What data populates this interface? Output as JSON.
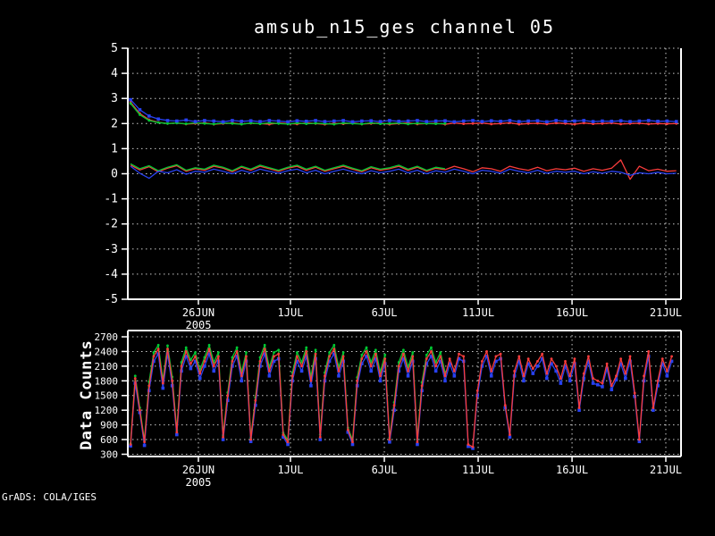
{
  "title": "amsub_n15_ges channel 05",
  "footer": "GrADS: COLA/IGES",
  "colors": {
    "background": "#000000",
    "foreground": "#ffffff",
    "grid": "#c8c8c8",
    "red": "#fa3c3c",
    "green": "#00c832",
    "blue": "#2841f0"
  },
  "chart_data": [
    {
      "type": "line",
      "panel": "top",
      "title": "amsub_n15_ges channel 05",
      "xlabel": "",
      "ylabel": "",
      "ylim": [
        -5,
        5
      ],
      "yticks": [
        5,
        4,
        3,
        2,
        1,
        0,
        -1,
        -2,
        -3,
        -4,
        -5
      ],
      "grid": "dotted",
      "frame_top_solid": false,
      "xticks": {
        "fracs": [
          0.1276,
          0.294,
          0.4637,
          0.6333,
          0.803,
          0.9725
        ],
        "labels": [
          "26JUN",
          "1JUL",
          "6JUL",
          "11JUL",
          "16JUL",
          "21JUL"
        ],
        "sublabel": "2005",
        "sublabel_index": 0
      },
      "series": [
        {
          "name": "red-line-upper",
          "color": "red",
          "marker": "circle",
          "x_start_frac": 0.005,
          "x_step_frac": 0.01672,
          "values": [
            2.85,
            2.4,
            2.15,
            2.05,
            2.0,
            2.02,
            1.98,
            2.0,
            2.03,
            1.97,
            2.0,
            2.02,
            1.98,
            2.01,
            2.0,
            1.97,
            2.02,
            2.0,
            1.98,
            2.03,
            2.0,
            1.97,
            2.01,
            1.99,
            2.02,
            1.98,
            2.0,
            2.02,
            1.97,
            2.0,
            2.03,
            1.98,
            2.0,
            2.01,
            1.97,
            2.02,
            1.99,
            2.0,
            2.02,
            1.98,
            2.0,
            2.03,
            1.97,
            2.0,
            2.01,
            1.98,
            2.02,
            2.0,
            1.97,
            2.02,
            1.99,
            2.0,
            2.02,
            1.98,
            2.0,
            2.01,
            1.98,
            2.0,
            1.99,
            2.0
          ]
        },
        {
          "name": "green-line-upper",
          "color": "green",
          "marker": "circle",
          "x_start_frac": 0.005,
          "x_step_frac": 0.01672,
          "values": [
            2.8,
            2.35,
            2.12,
            2.04,
            2.0,
            2.02,
            1.99,
            2.03,
            2.0,
            1.98,
            2.02,
            2.0,
            1.97,
            2.02,
            1.99,
            2.03,
            2.0,
            1.98,
            2.02,
            1.99,
            2.01,
            2.0,
            1.97,
            2.02,
            2.0,
            1.98,
            2.03,
            1.99,
            2.0,
            2.02,
            1.98,
            2.01,
            2.0,
            1.99,
            2.0
          ]
        },
        {
          "name": "blue-line-upper",
          "color": "blue",
          "marker": "square",
          "x_start_frac": 0.005,
          "x_step_frac": 0.01672,
          "values": [
            2.95,
            2.55,
            2.3,
            2.18,
            2.12,
            2.1,
            2.14,
            2.08,
            2.12,
            2.1,
            2.07,
            2.12,
            2.09,
            2.11,
            2.08,
            2.12,
            2.1,
            2.07,
            2.11,
            2.09,
            2.12,
            2.08,
            2.1,
            2.12,
            2.07,
            2.1,
            2.11,
            2.08,
            2.12,
            2.09,
            2.1,
            2.12,
            2.08,
            2.1,
            2.11,
            2.07,
            2.1,
            2.12,
            2.08,
            2.11,
            2.09,
            2.12,
            2.08,
            2.1,
            2.11,
            2.07,
            2.12,
            2.09,
            2.1,
            2.12,
            2.08,
            2.1,
            2.09,
            2.11,
            2.08,
            2.1,
            2.12,
            2.09,
            2.1,
            2.08
          ]
        },
        {
          "name": "red-line-lower",
          "color": "red",
          "marker": "none",
          "x_start_frac": 0.005,
          "x_step_frac": 0.01672,
          "values": [
            0.35,
            0.15,
            0.28,
            0.08,
            0.22,
            0.32,
            0.1,
            0.2,
            0.14,
            0.3,
            0.22,
            0.08,
            0.26,
            0.14,
            0.3,
            0.2,
            0.1,
            0.22,
            0.3,
            0.14,
            0.26,
            0.1,
            0.2,
            0.3,
            0.18,
            0.08,
            0.24,
            0.14,
            0.2,
            0.3,
            0.14,
            0.26,
            0.1,
            0.22,
            0.16,
            0.3,
            0.2,
            0.08,
            0.24,
            0.2,
            0.1,
            0.3,
            0.2,
            0.14,
            0.26,
            0.12,
            0.2,
            0.16,
            0.22,
            0.1,
            0.2,
            0.14,
            0.22,
            0.55,
            -0.22,
            0.3,
            0.12,
            0.18,
            0.1,
            0.12
          ]
        },
        {
          "name": "green-line-lower",
          "color": "green",
          "marker": "none",
          "x_start_frac": 0.005,
          "x_step_frac": 0.01672,
          "values": [
            0.4,
            0.2,
            0.32,
            0.12,
            0.26,
            0.36,
            0.14,
            0.24,
            0.18,
            0.34,
            0.26,
            0.12,
            0.3,
            0.18,
            0.34,
            0.24,
            0.14,
            0.26,
            0.34,
            0.18,
            0.3,
            0.14,
            0.24,
            0.34,
            0.22,
            0.12,
            0.28,
            0.18,
            0.24,
            0.34,
            0.18,
            0.3,
            0.14,
            0.26,
            0.2
          ]
        },
        {
          "name": "blue-line-lower",
          "color": "blue",
          "marker": "none",
          "x_start_frac": 0.005,
          "x_step_frac": 0.01672,
          "values": [
            0.3,
            0.02,
            -0.18,
            0.1,
            0.04,
            0.16,
            -0.02,
            0.1,
            0.06,
            0.18,
            0.1,
            0.0,
            0.14,
            0.04,
            0.18,
            0.1,
            0.02,
            0.12,
            0.18,
            0.04,
            0.14,
            0.0,
            0.1,
            0.18,
            0.08,
            0.0,
            0.12,
            0.04,
            0.1,
            0.18,
            0.04,
            0.14,
            0.0,
            0.12,
            0.06,
            0.18,
            0.1,
            0.0,
            0.14,
            0.1,
            0.02,
            0.18,
            0.1,
            0.04,
            0.14,
            0.02,
            0.1,
            0.06,
            0.1,
            0.0,
            0.08,
            0.02,
            0.1,
            0.06,
            -0.06,
            0.04,
            0.0,
            0.06,
            0.0,
            0.02
          ]
        }
      ]
    },
    {
      "type": "line",
      "panel": "bottom",
      "title": "",
      "xlabel": "",
      "ylabel": "Data Counts",
      "ylim": [
        254,
        2828
      ],
      "yticks": [
        2700,
        2400,
        2100,
        1800,
        1500,
        1200,
        900,
        600,
        300
      ],
      "grid": "dotted",
      "frame_top_solid": true,
      "xticks": {
        "fracs": [
          0.1276,
          0.294,
          0.4637,
          0.6333,
          0.803,
          0.9725
        ],
        "labels": [
          "26JUN",
          "1JUL",
          "6JUL",
          "11JUL",
          "16JUL",
          "21JUL"
        ],
        "sublabel": "2005",
        "sublabel_index": 0
      },
      "series": [
        {
          "name": "green-counts",
          "color": "green",
          "marker": "circle",
          "x_start_frac": 0.005,
          "x_step_frac": 0.00836,
          "values": [
            520,
            1900,
            1250,
            580,
            1780,
            2380,
            2530,
            1820,
            2520,
            1880,
            790,
            2180,
            2480,
            2230,
            2380,
            2020,
            2280,
            2530,
            2180,
            2380,
            690,
            1560,
            2280,
            2480,
            1980,
            2380,
            640,
            1460,
            2280,
            2530,
            2080,
            2380,
            2430,
            740,
            590,
            1970,
            2380,
            2180,
            2480,
            1880,
            2430,
            700,
            1970,
            2380,
            2530,
            2080,
            2380,
            840,
            590,
            1870,
            2330,
            2480,
            2180,
            2430,
            1980,
            2330,
            640,
            1360,
            2180,
            2430,
            2080,
            2380,
            600,
            1770,
            2330,
            2480,
            2180,
            2380,
            1980
          ]
        },
        {
          "name": "blue-counts",
          "color": "blue",
          "marker": "square",
          "x_start_frac": 0.005,
          "x_step_frac": 0.00836,
          "values": [
            470,
            1750,
            1150,
            480,
            1600,
            2200,
            2350,
            1650,
            2350,
            1700,
            700,
            2000,
            2300,
            2050,
            2200,
            1850,
            2100,
            2350,
            2000,
            2200,
            600,
            1400,
            2100,
            2300,
            1800,
            2200,
            560,
            1300,
            2100,
            2350,
            1900,
            2200,
            2250,
            650,
            500,
            1800,
            2200,
            2000,
            2300,
            1700,
            2250,
            600,
            1800,
            2200,
            2350,
            1900,
            2200,
            750,
            500,
            1700,
            2150,
            2300,
            2000,
            2250,
            1800,
            2150,
            550,
            1200,
            2000,
            2250,
            1900,
            2200,
            500,
            1600,
            2150,
            2300,
            2000,
            2200,
            1800,
            2150,
            1900,
            2250,
            2200,
            460,
            420,
            1500,
            2100,
            2300,
            1900,
            2200,
            2250,
            1250,
            650,
            1900,
            2200,
            1800,
            2150,
            1950,
            2100,
            2250,
            1850,
            2150,
            2000,
            1750,
            2100,
            1800,
            2150,
            1200,
            1850,
            2200,
            1750,
            1720,
            1680,
            2050,
            1620,
            1820,
            2150,
            1850,
            2200,
            1480,
            560,
            1800,
            2300,
            1200,
            1700,
            2150,
            1900,
            2200
          ]
        },
        {
          "name": "red-counts",
          "color": "red",
          "marker": "circle",
          "x_start_frac": 0.005,
          "x_step_frac": 0.00836,
          "values": [
            500,
            1850,
            1200,
            550,
            1700,
            2300,
            2450,
            1750,
            2450,
            1800,
            750,
            2100,
            2400,
            2150,
            2300,
            1950,
            2200,
            2450,
            2100,
            2300,
            650,
            1500,
            2200,
            2400,
            1900,
            2300,
            600,
            1400,
            2200,
            2450,
            2000,
            2300,
            2350,
            700,
            550,
            1900,
            2300,
            2100,
            2400,
            1800,
            2350,
            650,
            1900,
            2300,
            2450,
            2000,
            2300,
            800,
            550,
            1800,
            2250,
            2400,
            2100,
            2350,
            1900,
            2250,
            600,
            1300,
            2100,
            2350,
            2000,
            2300,
            550,
            1700,
            2250,
            2400,
            2100,
            2300,
            1900,
            2250,
            2000,
            2350,
            2300,
            500,
            450,
            1600,
            2200,
            2400,
            2000,
            2300,
            2350,
            1300,
            700,
            2000,
            2300,
            1900,
            2250,
            2050,
            2200,
            2350,
            1950,
            2250,
            2100,
            1850,
            2200,
            1900,
            2250,
            1250,
            1950,
            2300,
            1850,
            1800,
            1750,
            2150,
            1700,
            1900,
            2250,
            1950,
            2300,
            1550,
            600,
            1900,
            2400,
            1250,
            1800,
            2250,
            2000,
            2300
          ]
        }
      ]
    }
  ]
}
